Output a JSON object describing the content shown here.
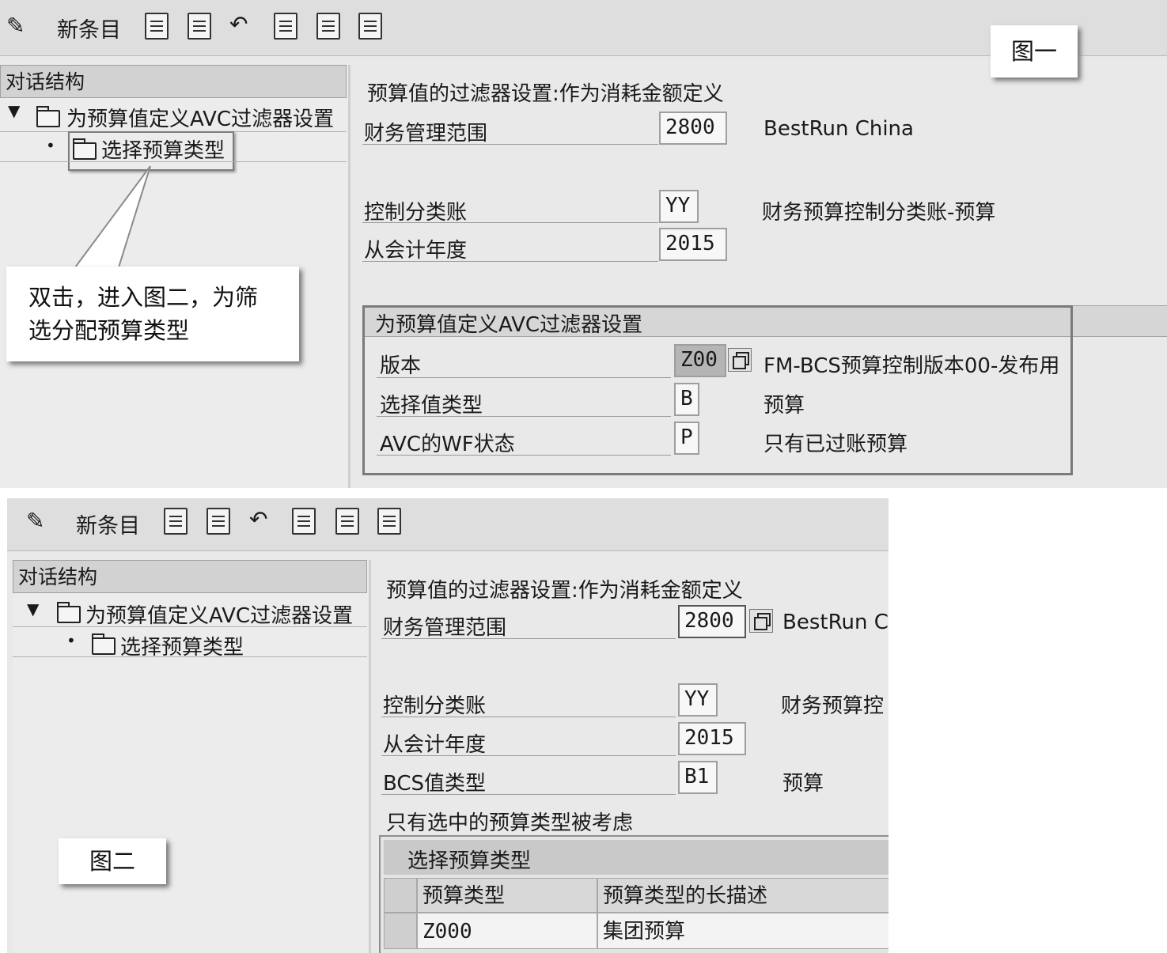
{
  "fig1": {
    "toolbar": {
      "new_entries": "新条目"
    },
    "dialog_structure": {
      "header": "对话结构",
      "node_root": "为预算值定义AVC过滤器设置",
      "node_child": "选择预算类型"
    },
    "form": {
      "title": "预算值的过滤器设置:作为消耗金额定义",
      "fm_area_label": "财务管理范围",
      "fm_area_value": "2800",
      "fm_area_text": "BestRun China",
      "ledger_label": "控制分类账",
      "ledger_value": "YY",
      "ledger_text": "财务预算控制分类账-预算",
      "year_label": "从会计年度",
      "year_value": "2015"
    },
    "group": {
      "title": "为预算值定义AVC过滤器设置",
      "version_label": "版本",
      "version_value": "Z00",
      "version_text": "FM-BCS预算控制版本00-发布用",
      "value_type_label": "选择值类型",
      "value_type_value": "B",
      "value_type_text": "预算",
      "wf_label": "AVC的WF状态",
      "wf_value": "P",
      "wf_text": "只有已过账预算"
    },
    "callout_tag": "图一",
    "callout_hint": [
      "双击，进入图二，为筛",
      "选分配预算类型"
    ]
  },
  "fig2": {
    "toolbar": {
      "new_entries": "新条目"
    },
    "dialog_structure": {
      "header": "对话结构",
      "node_root": "为预算值定义AVC过滤器设置",
      "node_child": "选择预算类型"
    },
    "form": {
      "title": "预算值的过滤器设置:作为消耗金额定义",
      "fm_area_label": "财务管理范围",
      "fm_area_value": "2800",
      "fm_area_text": "BestRun Ch",
      "ledger_label": "控制分类账",
      "ledger_value": "YY",
      "ledger_text": "财务预算控",
      "year_label": "从会计年度",
      "year_value": "2015",
      "bcs_label": "BCS值类型",
      "bcs_value": "B1",
      "bcs_text": "预算",
      "note": "只有选中的预算类型被考虑"
    },
    "table": {
      "title": "选择预算类型",
      "columns": [
        "预算类型",
        "预算类型的长描述"
      ],
      "rows": [
        [
          "Z000",
          "集团预算"
        ]
      ]
    },
    "callout_tag": "图二"
  }
}
